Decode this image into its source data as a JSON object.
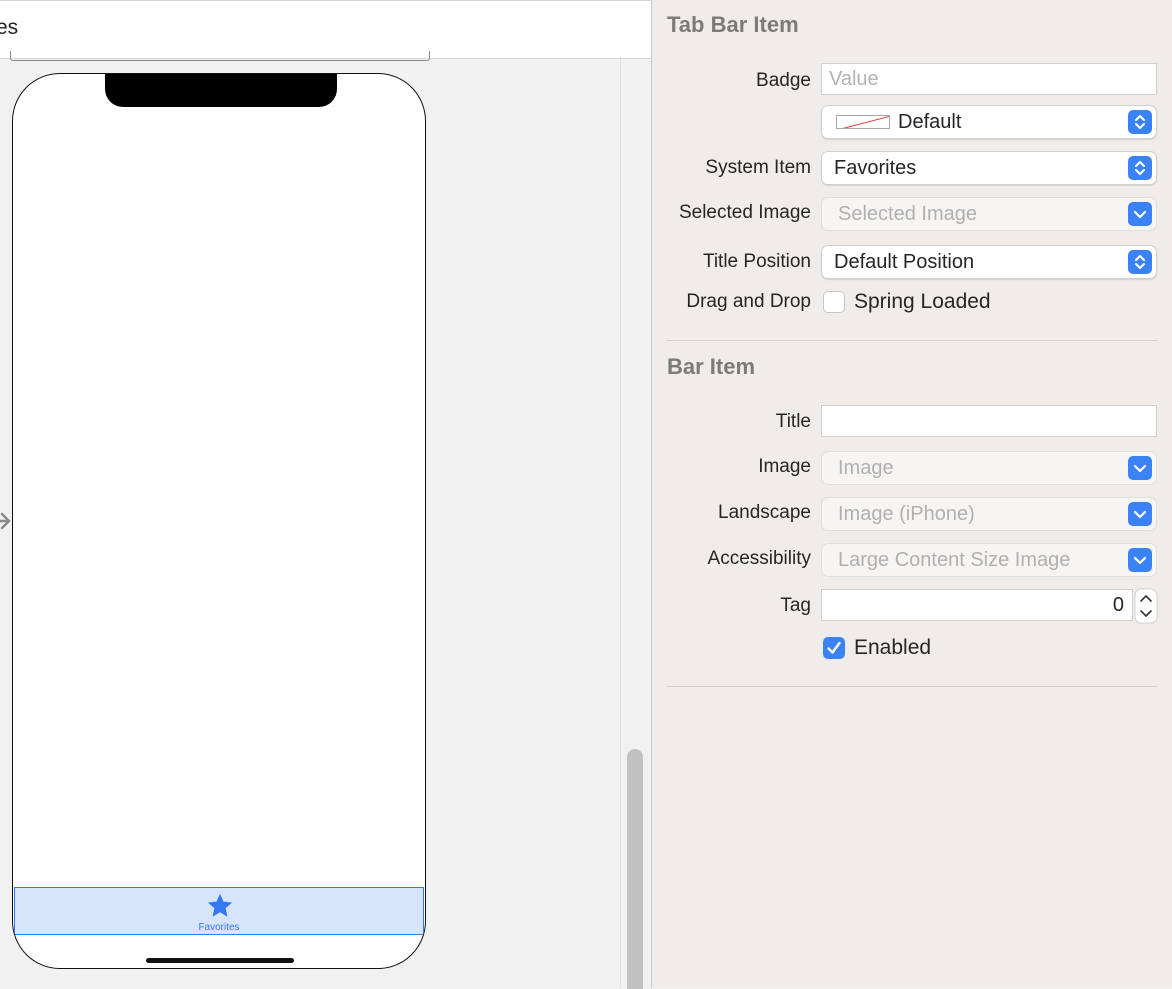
{
  "canvas": {
    "title_fragment": "es",
    "tab_bar_item_label": "Favorites"
  },
  "inspector": {
    "tab_bar_item_section": {
      "title": "Tab Bar Item",
      "badge_label": "Badge",
      "badge_placeholder": "Value",
      "badge_color_value": "Default",
      "system_item_label": "System Item",
      "system_item_value": "Favorites",
      "selected_image_label": "Selected Image",
      "selected_image_placeholder": "Selected Image",
      "title_position_label": "Title Position",
      "title_position_value": "Default Position",
      "drag_drop_label": "Drag and Drop",
      "spring_loaded_label": "Spring Loaded",
      "spring_loaded_checked": false
    },
    "bar_item_section": {
      "title": "Bar Item",
      "title_label": "Title",
      "title_value": "",
      "image_label": "Image",
      "image_placeholder": "Image",
      "landscape_label": "Landscape",
      "landscape_placeholder": "Image (iPhone)",
      "accessibility_label": "Accessibility",
      "accessibility_placeholder": "Large Content Size Image",
      "tag_label": "Tag",
      "tag_value": "0",
      "enabled_label": "Enabled",
      "enabled_checked": true
    }
  },
  "colors": {
    "accent": "#3478f6",
    "tab_bar_fill": "#d6e5fc",
    "inspector_bg": "#f0ecea"
  },
  "icons": [
    "arrow-right-icon",
    "star-icon",
    "up-down-chevron-icon",
    "chevron-down-icon",
    "checkmark-icon",
    "no-color-swatch-icon"
  ]
}
